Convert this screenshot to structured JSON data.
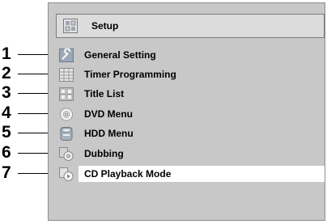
{
  "header": {
    "title": "Setup",
    "icon": "setup-icon"
  },
  "menu": {
    "items": [
      {
        "label": "General Setting",
        "icon": "wrench-icon",
        "callout": "1"
      },
      {
        "label": "Timer Programming",
        "icon": "timer-grid-icon",
        "callout": "2"
      },
      {
        "label": "Title List",
        "icon": "list-icon",
        "callout": "3"
      },
      {
        "label": "DVD Menu",
        "icon": "disc-icon",
        "callout": "4"
      },
      {
        "label": "HDD Menu",
        "icon": "hdd-icon",
        "callout": "5"
      },
      {
        "label": "Dubbing",
        "icon": "dubbing-icon",
        "callout": "6"
      },
      {
        "label": "CD Playback Mode",
        "icon": "cd-playback-icon",
        "callout": "7"
      }
    ],
    "selected_index": 6
  },
  "colors": {
    "panel": "#c8c8c8",
    "title_bar": "#dcdcdc",
    "selection": "#ffffff",
    "callout": "#000000"
  }
}
